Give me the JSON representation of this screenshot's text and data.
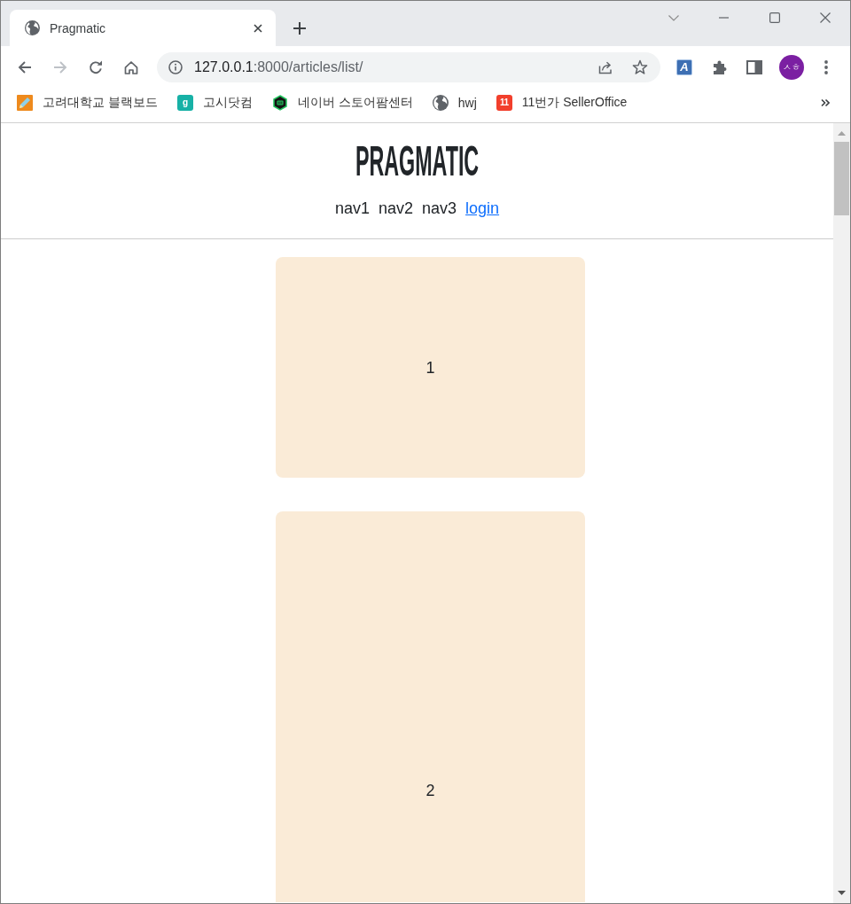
{
  "tabs": [
    {
      "title": "Pragmatic",
      "selected": true
    }
  ],
  "toolbar": {
    "buttons": [
      {
        "kind": "back",
        "disabled": false
      },
      {
        "kind": "forward",
        "disabled": true
      },
      {
        "kind": "reload",
        "disabled": false
      },
      {
        "kind": "home",
        "disabled": false
      }
    ],
    "address": {
      "host": "127.0.0.1",
      "path": ":8000/articles/list/"
    },
    "extension_label": "A",
    "profile_initials": "ㅅㅎ"
  },
  "bookmarks": [
    {
      "kind": "pencil",
      "label": "고려대학교 블랙보드"
    },
    {
      "kind": "tile",
      "favicon_text": "g",
      "color": "#17b1a6",
      "label": "고시닷컴"
    },
    {
      "kind": "hexagon",
      "label": "네이버 스토어팜센터"
    },
    {
      "kind": "globe",
      "label": "hwj"
    },
    {
      "kind": "tile",
      "favicon_text": "11",
      "color": "#f23f2c",
      "label": "11번가 SellerOffice"
    }
  ],
  "page": {
    "brand": "PRAGMATIC",
    "nav": [
      {
        "kind": "text",
        "label": "nav1"
      },
      {
        "kind": "text",
        "label": "nav2"
      },
      {
        "kind": "text",
        "label": "nav3"
      },
      {
        "kind": "link",
        "label": "login"
      }
    ],
    "articles": [
      {
        "label": "1"
      },
      {
        "label": "2"
      }
    ]
  }
}
